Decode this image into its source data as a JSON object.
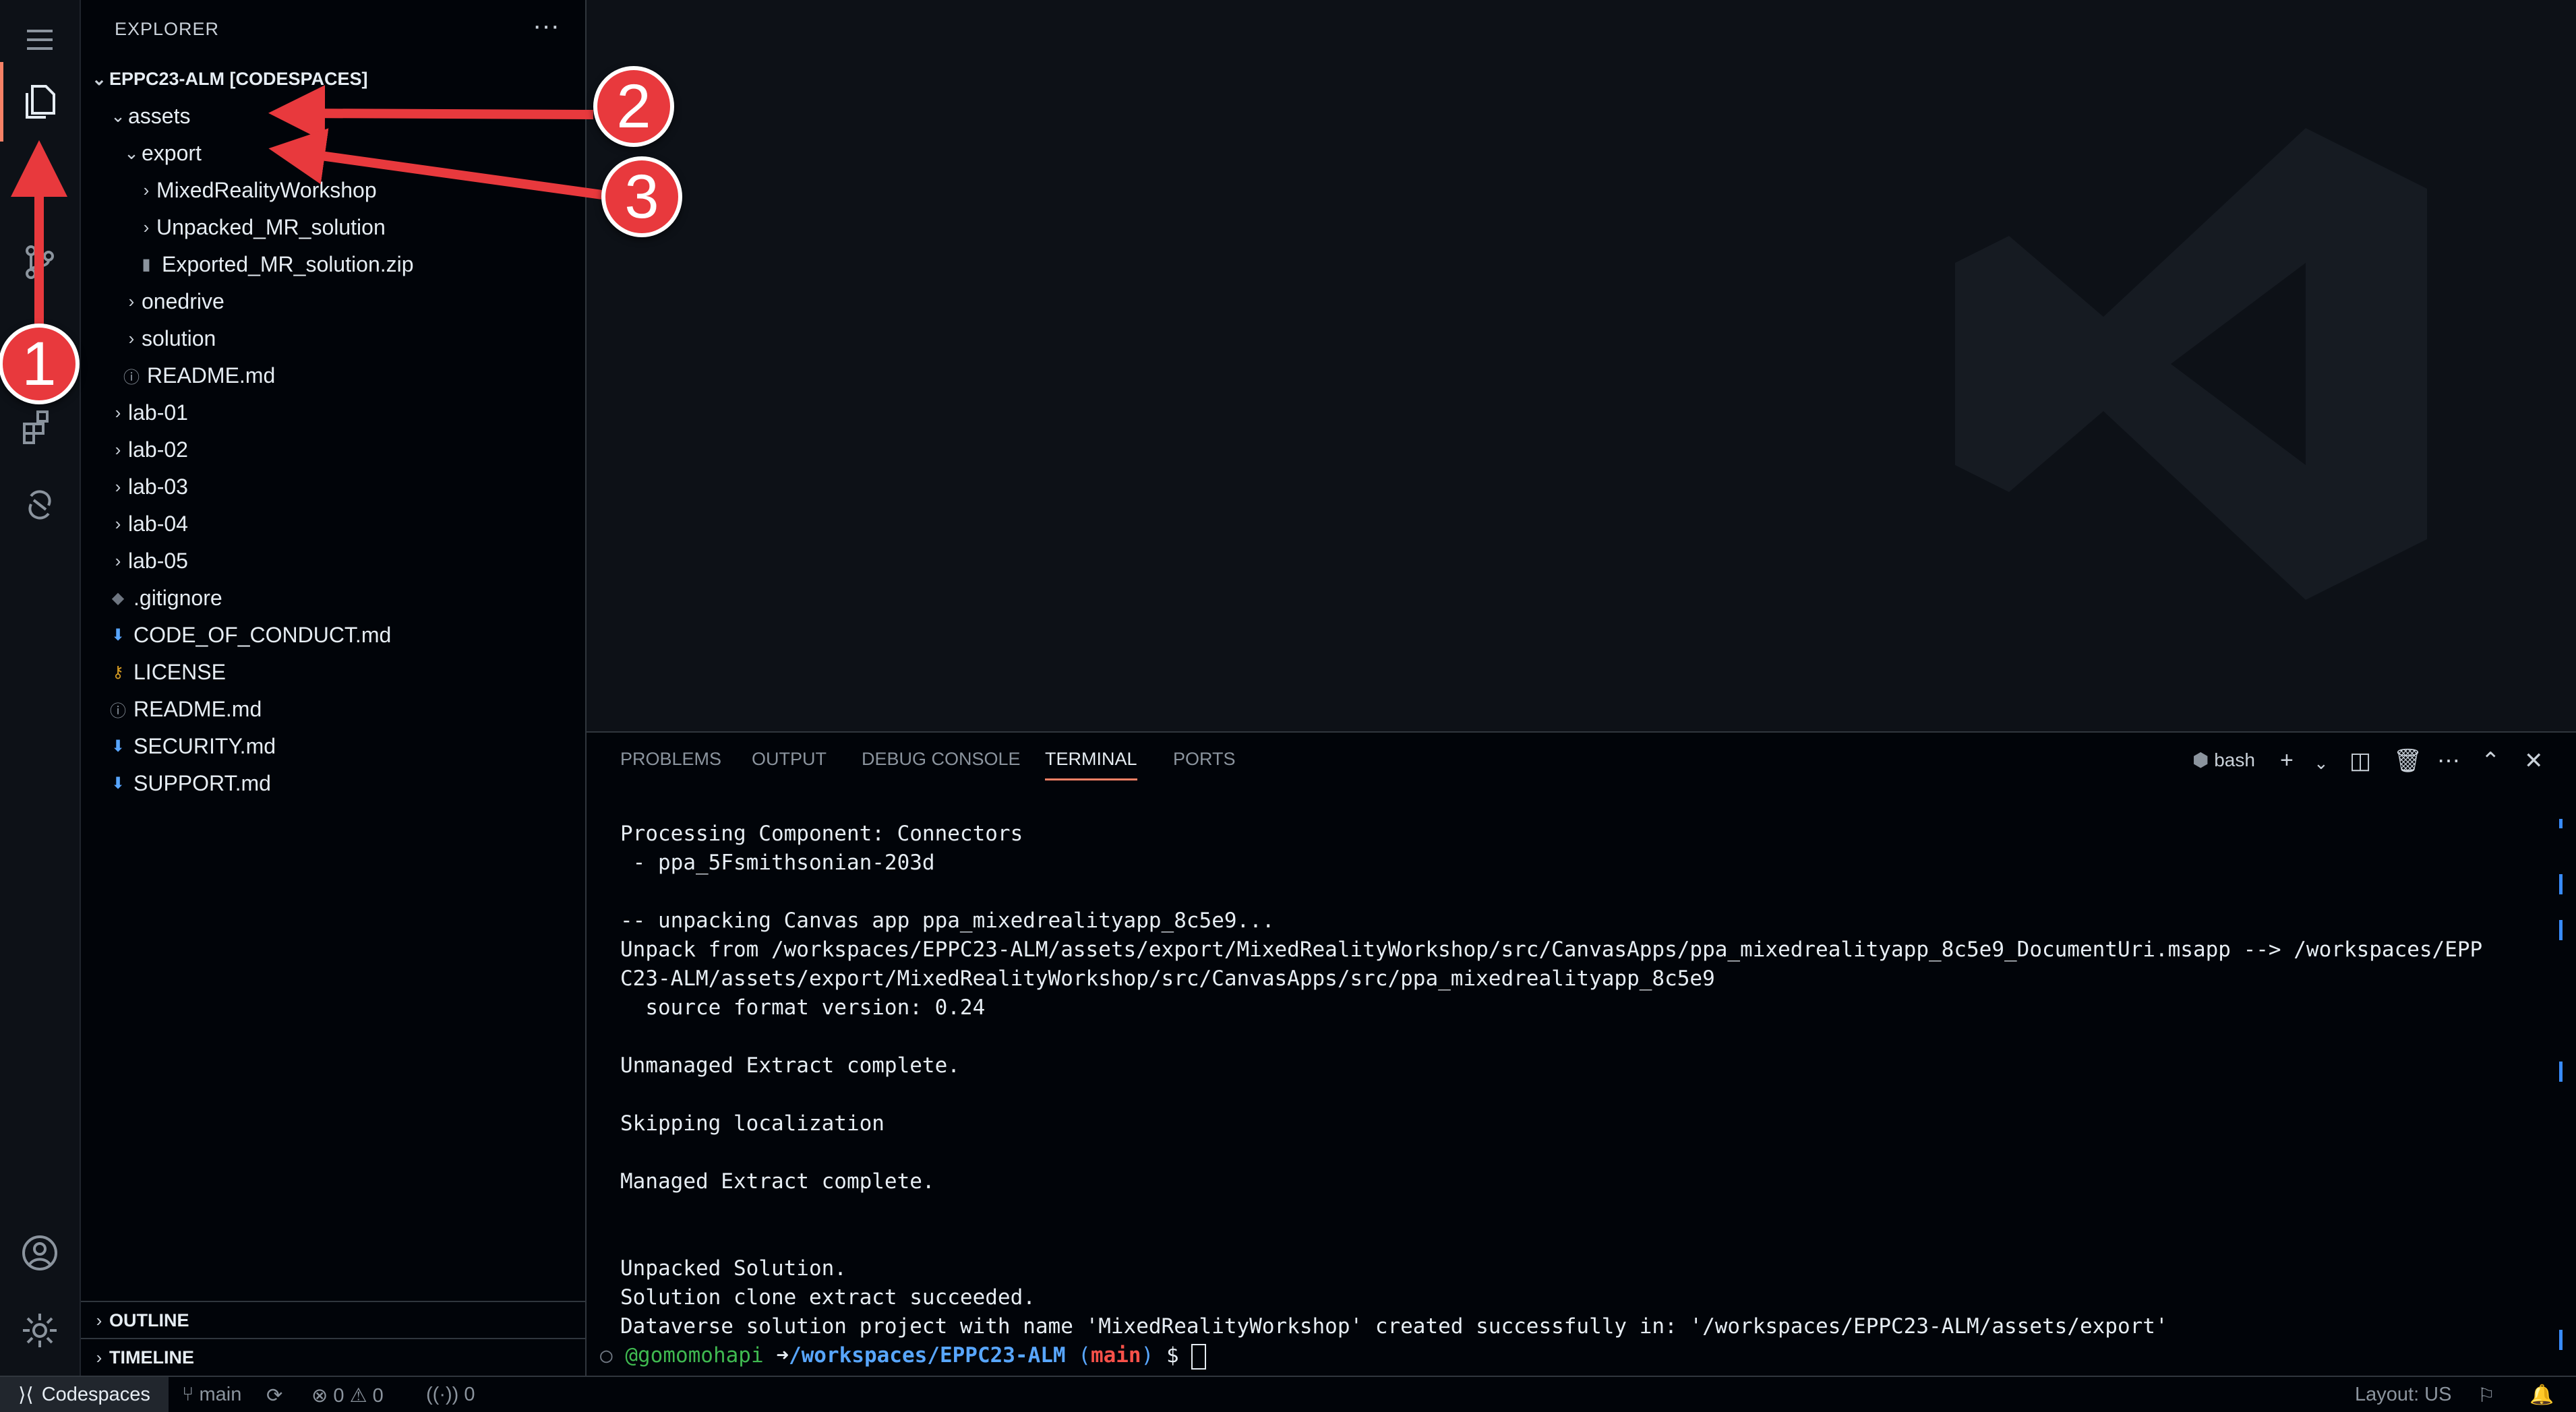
{
  "explorer": {
    "title": "EXPLORER",
    "more": "···",
    "root": "EPPC23-ALM [CODESPACES]",
    "items": [
      {
        "label": "assets",
        "kind": "folder-open"
      },
      {
        "label": "export",
        "kind": "folder-open"
      },
      {
        "label": "MixedRealityWorkshop",
        "kind": "folder"
      },
      {
        "label": "Unpacked_MR_solution",
        "kind": "folder"
      },
      {
        "label": "Exported_MR_solution.zip",
        "kind": "zip"
      },
      {
        "label": "onedrive",
        "kind": "folder"
      },
      {
        "label": "solution",
        "kind": "folder"
      },
      {
        "label": "README.md",
        "kind": "info"
      },
      {
        "label": "lab-01",
        "kind": "folder"
      },
      {
        "label": "lab-02",
        "kind": "folder"
      },
      {
        "label": "lab-03",
        "kind": "folder"
      },
      {
        "label": "lab-04",
        "kind": "folder"
      },
      {
        "label": "lab-05",
        "kind": "folder"
      },
      {
        "label": ".gitignore",
        "kind": "git"
      },
      {
        "label": "CODE_OF_CONDUCT.md",
        "kind": "md-download"
      },
      {
        "label": "LICENSE",
        "kind": "license"
      },
      {
        "label": "README.md",
        "kind": "info"
      },
      {
        "label": "SECURITY.md",
        "kind": "md-download"
      },
      {
        "label": "SUPPORT.md",
        "kind": "md-download"
      }
    ],
    "outline": "OUTLINE",
    "timeline": "TIMELINE"
  },
  "panel": {
    "tabs": [
      "PROBLEMS",
      "OUTPUT",
      "DEBUG CONSOLE",
      "TERMINAL",
      "PORTS"
    ],
    "active_tab": "TERMINAL",
    "shell": "bash",
    "terminal_lines": [
      "Processing Component: Connectors",
      " - ppa_5Fsmithsonian-203d",
      "",
      "-- unpacking Canvas app ppa_mixedrealityapp_8c5e9...",
      "Unpack from /workspaces/EPPC23-ALM/assets/export/MixedRealityWorkshop/src/CanvasApps/ppa_mixedrealityapp_8c5e9_DocumentUri.msapp --> /workspaces/EPP",
      "C23-ALM/assets/export/MixedRealityWorkshop/src/CanvasApps/src/ppa_mixedrealityapp_8c5e9",
      "  source format version: 0.24",
      "",
      "Unmanaged Extract complete.",
      "",
      "Skipping localization",
      "",
      "Managed Extract complete.",
      "",
      "",
      "Unpacked Solution.",
      "Solution clone extract succeeded.",
      "Dataverse solution project with name 'MixedRealityWorkshop' created successfully in: '/workspaces/EPPC23-ALM/assets/export'"
    ],
    "prompt": {
      "user": "@gomomohapi",
      "arrow": "➜",
      "path": "/workspaces/EPPC23-ALM",
      "branch_open": "(",
      "branch": "main",
      "branch_close": ")",
      "symbol": "$"
    }
  },
  "status": {
    "remote": "Codespaces",
    "branch": "main",
    "errors": "0",
    "warnings": "0",
    "ports": "0",
    "layout": "Layout: US"
  },
  "annotations": [
    "1",
    "2",
    "3"
  ],
  "colors": {
    "accent": "#f78166",
    "annotation": "#e8393d",
    "prompt_user": "#3fb950",
    "prompt_path": "#58a6ff",
    "prompt_branch": "#f85149"
  }
}
